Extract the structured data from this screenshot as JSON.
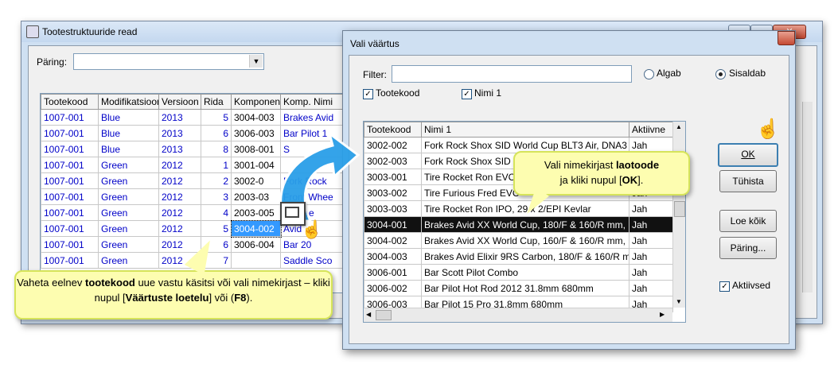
{
  "back_window": {
    "title": "Tootestruktuuride read",
    "query_label": "Päring:",
    "query_value": "",
    "columns": [
      "Tootekood",
      "Modifikatsioon",
      "Versioon",
      "Rida",
      "Komponent",
      "Komp. Nimi"
    ],
    "rows": [
      [
        "1007-001",
        "Blue",
        "2013",
        "5",
        "3004-003",
        "Brakes Avid"
      ],
      [
        "1007-001",
        "Blue",
        "2013",
        "6",
        "3006-003",
        "Bar Pilot 1"
      ],
      [
        "1007-001",
        "Blue",
        "2013",
        "8",
        "3008-001",
        "S"
      ],
      [
        "1007-001",
        "Green",
        "2012",
        "1",
        "3001-004",
        ""
      ],
      [
        "1007-001",
        "Green",
        "2012",
        "2",
        "3002-0",
        "Fork Rock"
      ],
      [
        "1007-001",
        "Green",
        "2012",
        "3",
        "2003-03",
        "Front Whee"
      ],
      [
        "1007-001",
        "Green",
        "2012",
        "4",
        "2003-005",
        "r Whee"
      ],
      [
        "1007-001",
        "Green",
        "2012",
        "5",
        "3004-002",
        "Avid"
      ],
      [
        "1007-001",
        "Green",
        "2012",
        "6",
        "3006-004",
        "Bar 20"
      ],
      [
        "1007-001",
        "Green",
        "2012",
        "7",
        "",
        "Saddle Sco"
      ]
    ]
  },
  "dialog": {
    "title": "Vali väärtus",
    "filter_label": "Filter:",
    "filter_value": "",
    "radio_algab": "Algab",
    "radio_sisaldab": "Sisaldab",
    "check_tootekood": "Tootekood",
    "check_nimi": "Nimi 1",
    "columns": [
      "Tootekood",
      "Nimi 1",
      "Aktiivne"
    ],
    "rows": [
      [
        "3002-002",
        "Fork Rock Shox SID World Cup BLT3 Air, DNA3",
        "Jah"
      ],
      [
        "3002-003",
        "Fork Rock Shox SID",
        "Jah"
      ],
      [
        "3003-001",
        "Tire Rocket Ron EVC",
        "Jah"
      ],
      [
        "3003-002",
        "Tire Furious Fred EVC",
        "Jah"
      ],
      [
        "3003-003",
        "Tire Rocket Ron IPO, 29 x 2/EPI Kevlar",
        "Jah"
      ],
      [
        "3004-001",
        "Brakes Avid XX World Cup, 180/F & 160/R mm, I",
        "Jah"
      ],
      [
        "3004-002",
        "Brakes Avid XX World Cup, 160/F & 160/R mm, I",
        "Jah"
      ],
      [
        "3004-003",
        "Brakes Avid Elixir 9RS Carbon, 180/F & 160/R mr",
        "Jah"
      ],
      [
        "3006-001",
        "Bar Scott Pilot Combo",
        "Jah"
      ],
      [
        "3006-002",
        "Bar Pilot Hot Rod 2012 31.8mm 680mm",
        "Jah"
      ],
      [
        "3006-003",
        "Bar Pilot 15 Pro 31.8mm 680mm",
        "Jah"
      ]
    ],
    "btn_ok": "OK",
    "btn_tuhista": "Tühista",
    "btn_loe_koik": "Loe kõik",
    "btn_paring": "Päring...",
    "check_aktiivsed": "Aktiivsed"
  },
  "callout_left": {
    "t1": "Vaheta eelnev ",
    "b1": "tootekood",
    "t2": " uue vastu käsitsi või vali nimekirjast – kliki nupul [",
    "b2": "Väärtuste loetelu",
    "t3": "] või (",
    "b3": "F8",
    "t4": ")."
  },
  "callout_right": {
    "t1": "Vali nimekirjast ",
    "b1": "laotoode",
    "t2": "ja kliki nupul [",
    "b2": "OK",
    "t3": "]."
  },
  "colors": {
    "accent_blue": "#2a9fe8",
    "highlight_row": "#111111",
    "callout_fill": "#fdfdb0",
    "callout_border": "#d6e45a"
  }
}
